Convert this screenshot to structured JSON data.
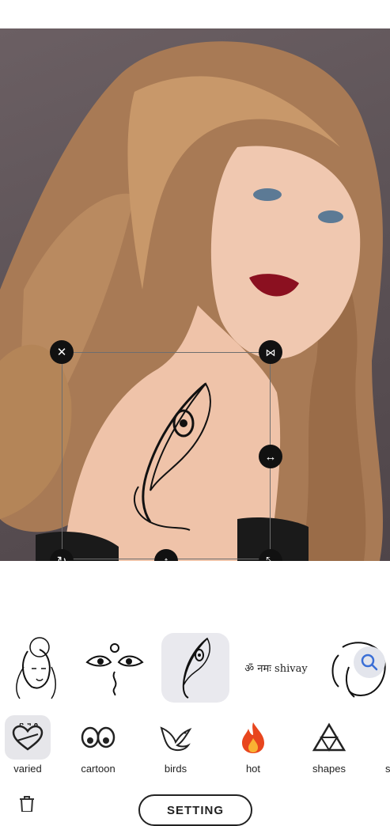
{
  "editor": {
    "image_description_hidden": "",
    "handles": {
      "delete": "✕",
      "flip": "⋈",
      "stretch": "↔",
      "move": "↕",
      "rotate": "↻",
      "resize": "⤡"
    }
  },
  "tattoos": [
    {
      "name": "shiva-face",
      "selected": false
    },
    {
      "name": "third-eye",
      "selected": false
    },
    {
      "name": "peacock-feather",
      "selected": true
    },
    {
      "name": "om-namah-shivay",
      "text": "ॐ नमः shivay",
      "selected": false
    },
    {
      "name": "ganesha",
      "selected": false
    }
  ],
  "categories": [
    {
      "label": "varied",
      "icon": "flaming-heart-icon",
      "selected": true
    },
    {
      "label": "cartoon",
      "icon": "cartoon-eyes-icon",
      "selected": false
    },
    {
      "label": "birds",
      "icon": "dove-icon",
      "selected": false
    },
    {
      "label": "hot",
      "icon": "flame-icon",
      "selected": false
    },
    {
      "label": "shapes",
      "icon": "triangle-icon",
      "selected": false
    },
    {
      "label": "s",
      "icon": "",
      "selected": false
    }
  ],
  "bottom": {
    "button_label": "SETTING"
  },
  "colors": {
    "accent_search": "#3b6fd6",
    "flame": "#e8461e",
    "handle_bg": "#111111"
  }
}
